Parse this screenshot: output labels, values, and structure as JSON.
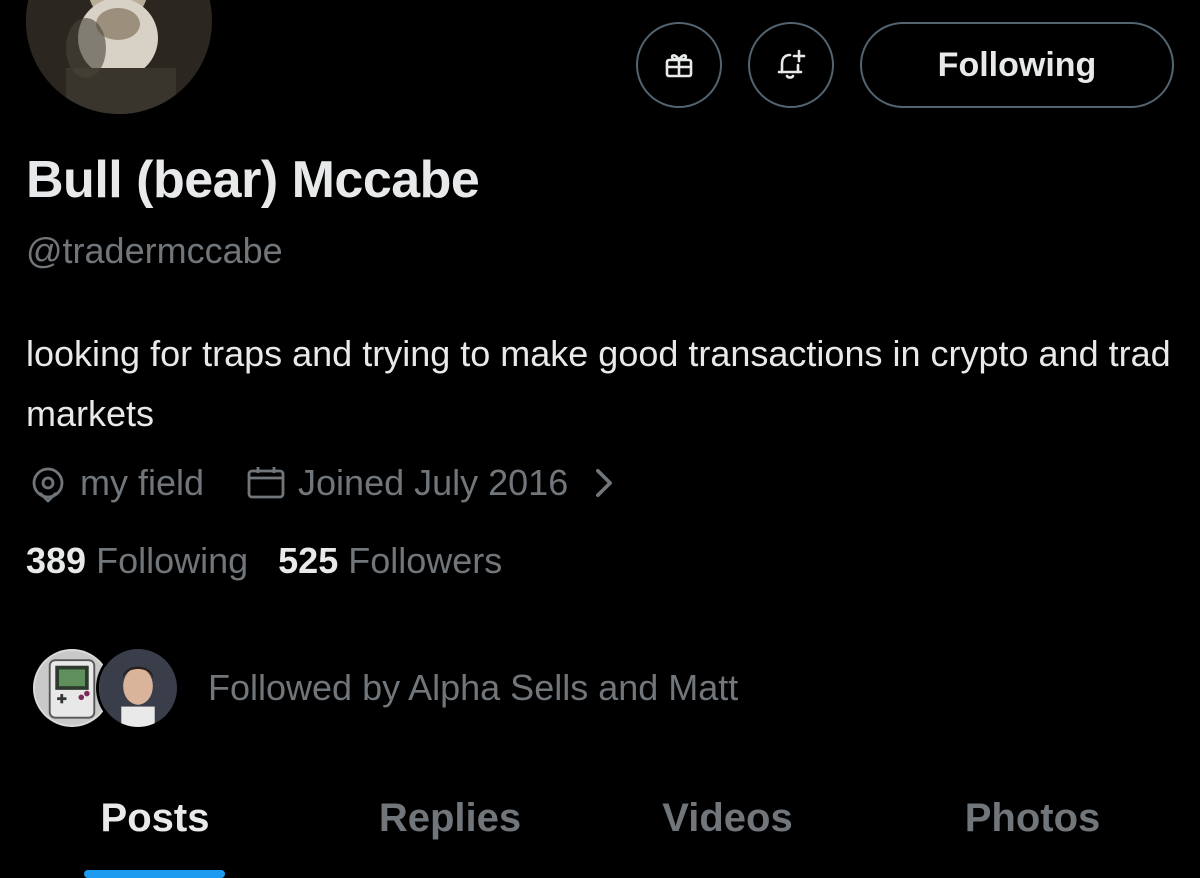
{
  "profile": {
    "display_name": "Bull (bear) Mccabe",
    "handle": "@tradermccabe",
    "bio": "looking for traps and trying to make good transactions in crypto and trad markets",
    "location": "my field",
    "joined": "Joined July 2016"
  },
  "actions": {
    "gift_icon": "gift-icon",
    "bell_icon": "bell-plus-icon",
    "following_label": "Following"
  },
  "counts": {
    "following_count": "389",
    "following_label": "Following",
    "followers_count": "525",
    "followers_label": "Followers"
  },
  "followed_by": {
    "text": "Followed by Alpha Sells and Matt"
  },
  "tabs": [
    {
      "label": "Posts",
      "active": true
    },
    {
      "label": "Replies",
      "active": false
    },
    {
      "label": "Videos",
      "active": false
    },
    {
      "label": "Photos",
      "active": false
    }
  ],
  "colors": {
    "background": "#000000",
    "text_primary": "#e7e9ea",
    "text_secondary": "#71767b",
    "border": "#536471",
    "accent": "#1d9bf0"
  }
}
